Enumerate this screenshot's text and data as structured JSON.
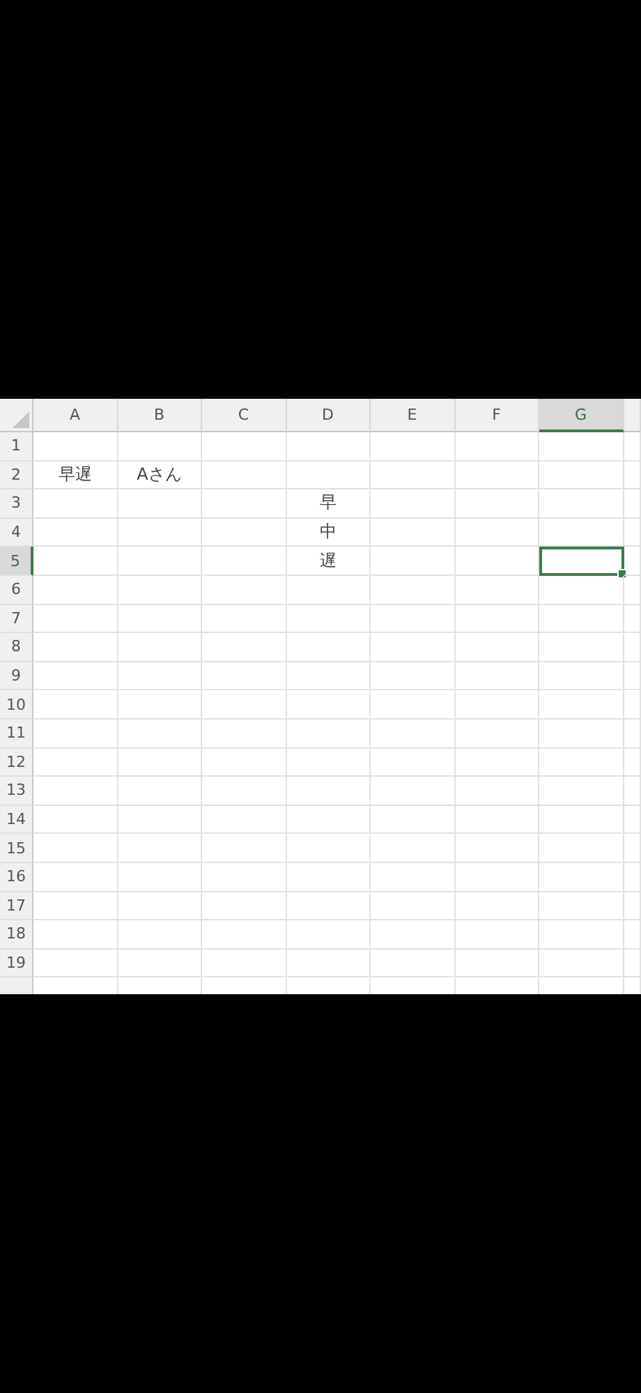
{
  "columns": [
    {
      "label": "A",
      "selected": false
    },
    {
      "label": "B",
      "selected": false
    },
    {
      "label": "C",
      "selected": false
    },
    {
      "label": "D",
      "selected": false
    },
    {
      "label": "E",
      "selected": false
    },
    {
      "label": "F",
      "selected": false
    },
    {
      "label": "G",
      "selected": true
    }
  ],
  "rows": [
    {
      "number": "1",
      "selected": false,
      "cells": {}
    },
    {
      "number": "2",
      "selected": false,
      "cells": {
        "a": {
          "text": "早遅",
          "selected": false
        },
        "b": {
          "text": "Aさん",
          "selected": false
        }
      }
    },
    {
      "number": "3",
      "selected": false,
      "cells": {
        "d": {
          "text": "早",
          "selected": false
        }
      }
    },
    {
      "number": "4",
      "selected": false,
      "cells": {
        "d": {
          "text": "中",
          "selected": false
        }
      }
    },
    {
      "number": "5",
      "selected": true,
      "cells": {
        "d": {
          "text": "遅",
          "selected": false
        },
        "g": {
          "selected": true
        }
      }
    },
    {
      "number": "6",
      "selected": false,
      "cells": {}
    },
    {
      "number": "7",
      "selected": false,
      "cells": {}
    },
    {
      "number": "8",
      "selected": false,
      "cells": {}
    },
    {
      "number": "9",
      "selected": false,
      "cells": {}
    },
    {
      "number": "10",
      "selected": false,
      "cells": {}
    },
    {
      "number": "11",
      "selected": false,
      "cells": {}
    },
    {
      "number": "12",
      "selected": false,
      "cells": {}
    },
    {
      "number": "13",
      "selected": false,
      "cells": {}
    },
    {
      "number": "14",
      "selected": false,
      "cells": {}
    },
    {
      "number": "15",
      "selected": false,
      "cells": {}
    },
    {
      "number": "16",
      "selected": false,
      "cells": {}
    },
    {
      "number": "17",
      "selected": false,
      "cells": {}
    },
    {
      "number": "18",
      "selected": false,
      "cells": {}
    },
    {
      "number": "19",
      "selected": false,
      "cells": {}
    }
  ]
}
